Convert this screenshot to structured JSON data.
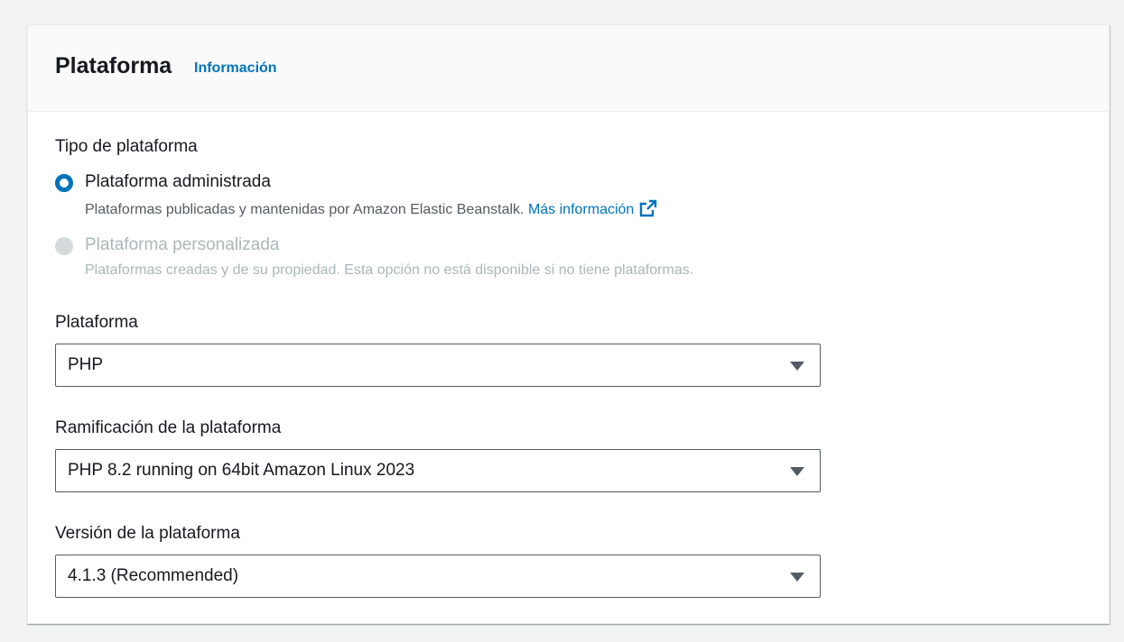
{
  "header": {
    "title": "Plataforma",
    "info_link": "Información"
  },
  "platform_type": {
    "label": "Tipo de plataforma",
    "options": [
      {
        "label": "Plataforma administrada",
        "description": "Plataformas publicadas y mantenidas por Amazon Elastic Beanstalk.",
        "link_text": "Más información",
        "link_icon": "external-link-icon",
        "selected": true,
        "disabled": false
      },
      {
        "label": "Plataforma personalizada",
        "description": "Plataformas creadas y de su propiedad. Esta opción no está disponible si no tiene plataformas.",
        "selected": false,
        "disabled": true
      }
    ]
  },
  "platform": {
    "label": "Plataforma",
    "value": "PHP"
  },
  "branch": {
    "label": "Ramificación de la plataforma",
    "value": "PHP 8.2 running on 64bit Amazon Linux 2023"
  },
  "version": {
    "label": "Versión de la plataforma",
    "value": "4.1.3 (Recommended)"
  },
  "colors": {
    "accent": "#0073bb",
    "text": "#16191f",
    "muted": "#545b64",
    "disabled": "#aab7b8"
  }
}
